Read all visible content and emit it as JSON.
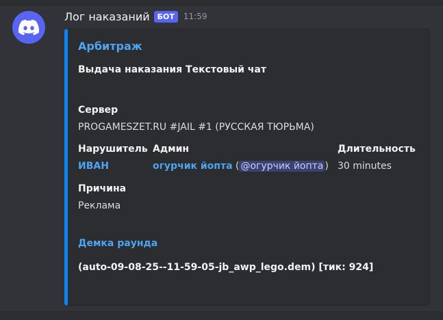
{
  "message": {
    "author": "Лог наказаний",
    "bot_tag": "БОТ",
    "timestamp": "11:59",
    "avatar_icon": "discord-logo-icon"
  },
  "embed": {
    "accent_color": "#0a84f5",
    "title": "Арбитраж",
    "description": "Выдача наказания Текстовый чат",
    "server": {
      "label": "Сервер",
      "value": "PROGAMESZET.RU #JAIL #1 (РУССКАЯ ТЮРЬМА)"
    },
    "violator": {
      "label": "Нарушитель",
      "value": "ИВАН"
    },
    "admin": {
      "label": "Админ",
      "name": "огурчик йопта",
      "open_paren": " (",
      "mention": "@огурчик йопта",
      "close_paren": ")"
    },
    "duration": {
      "label": "Длительность",
      "value": "30 minutes"
    },
    "reason": {
      "label": "Причина",
      "value": "Реклама"
    },
    "demo": {
      "title": "Демка раунда",
      "value": "(auto-09-08-25--11-59-05-jb_awp_lego.dem) [тик: 924]"
    }
  }
}
